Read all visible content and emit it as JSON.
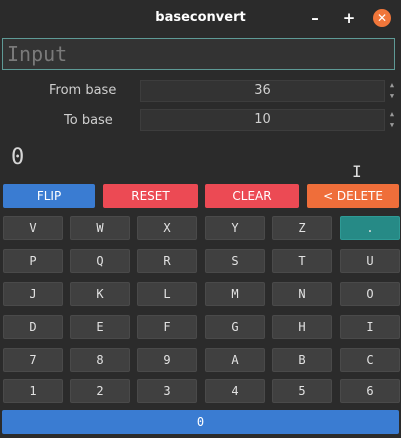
{
  "window": {
    "title": "baseconvert",
    "min": "–",
    "max": "+",
    "close": "✕"
  },
  "input": {
    "placeholder": "Input",
    "value": ""
  },
  "from_base": {
    "label": "From base",
    "value": "36"
  },
  "to_base": {
    "label": "To base",
    "value": "10"
  },
  "result": "0",
  "actions": {
    "flip": "FLIP",
    "reset": "RESET",
    "clear": "CLEAR",
    "delete": "< DELETE"
  },
  "keys": [
    [
      "V",
      "W",
      "X",
      "Y",
      "Z",
      "."
    ],
    [
      "P",
      "Q",
      "R",
      "S",
      "T",
      "U"
    ],
    [
      "J",
      "K",
      "L",
      "M",
      "N",
      "O"
    ],
    [
      "D",
      "E",
      "F",
      "G",
      "H",
      "I"
    ],
    [
      "7",
      "8",
      "9",
      "A",
      "B",
      "C"
    ],
    [
      "1",
      "2",
      "3",
      "4",
      "5",
      "6"
    ]
  ],
  "zero_key": "0"
}
